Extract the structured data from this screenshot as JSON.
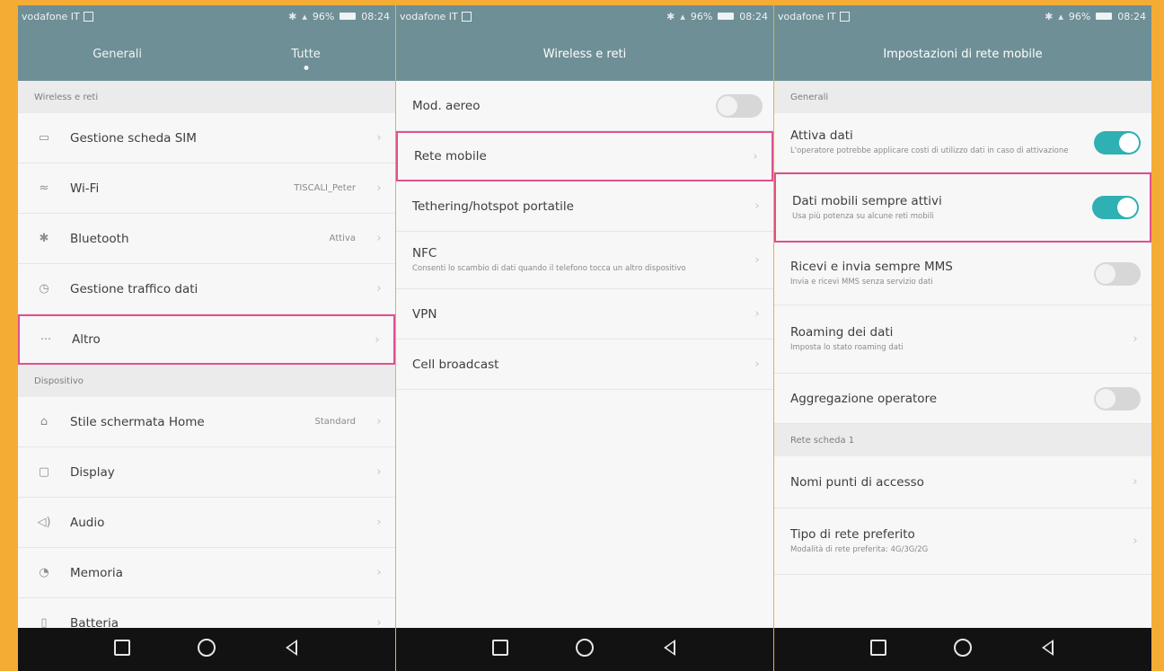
{
  "status": {
    "carrier": "vodafone IT",
    "battery": "96%",
    "time": "08:24"
  },
  "screen1": {
    "tabs": [
      {
        "label": "Generali"
      },
      {
        "label": "Tutte"
      }
    ],
    "section_wireless": "Wireless e reti",
    "items": [
      {
        "label": "Gestione scheda SIM",
        "value": "",
        "icon": "sim-card-icon"
      },
      {
        "label": "Wi-Fi",
        "value": "TISCALI_Peter",
        "icon": "wifi-icon"
      },
      {
        "label": "Bluetooth",
        "value": "Attiva",
        "icon": "bluetooth-icon"
      },
      {
        "label": "Gestione traffico dati",
        "value": "",
        "icon": "data-usage-icon"
      },
      {
        "label": "Altro",
        "value": "",
        "icon": "more-dots-icon"
      }
    ],
    "section_device": "Dispositivo",
    "device_items": [
      {
        "label": "Stile schermata Home",
        "value": "Standard",
        "icon": "home-icon"
      },
      {
        "label": "Display",
        "value": "",
        "icon": "display-icon"
      },
      {
        "label": "Audio",
        "value": "",
        "icon": "audio-icon"
      },
      {
        "label": "Memoria",
        "value": "",
        "icon": "memory-icon"
      },
      {
        "label": "Batteria",
        "value": "",
        "icon": "battery-icon"
      }
    ]
  },
  "screen2": {
    "title": "Wireless e reti",
    "items": [
      {
        "label": "Mod. aereo"
      },
      {
        "label": "Rete mobile"
      },
      {
        "label": "Tethering/hotspot portatile"
      },
      {
        "label": "NFC",
        "sub": "Consenti lo scambio di dati quando il telefono tocca un altro dispositivo"
      },
      {
        "label": "VPN"
      },
      {
        "label": "Cell broadcast"
      }
    ]
  },
  "screen3": {
    "title": "Impostazioni di rete mobile",
    "section_general": "Generali",
    "items": [
      {
        "label": "Attiva dati",
        "sub": "L'operatore potrebbe applicare costi di utilizzo dati in caso di attivazione"
      },
      {
        "label": "Dati mobili sempre attivi",
        "sub": "Usa più potenza su alcune reti mobili"
      },
      {
        "label": "Ricevi e invia sempre MMS",
        "sub": "Invia e ricevi MMS senza servizio dati"
      },
      {
        "label": "Roaming dei dati",
        "sub": "Imposta lo stato roaming dati"
      },
      {
        "label": "Aggregazione operatore"
      }
    ],
    "section_sim": "Rete scheda 1",
    "sim_items": [
      {
        "label": "Nomi punti di accesso"
      },
      {
        "label": "Tipo di rete preferito",
        "sub": "Modalità di rete preferita: 4G/3G/2G"
      }
    ]
  },
  "colors": {
    "frame": "#f4ac35",
    "header": "#6f8f96",
    "highlight": "#e0508e",
    "toggle_on": "#2fb0b3"
  }
}
